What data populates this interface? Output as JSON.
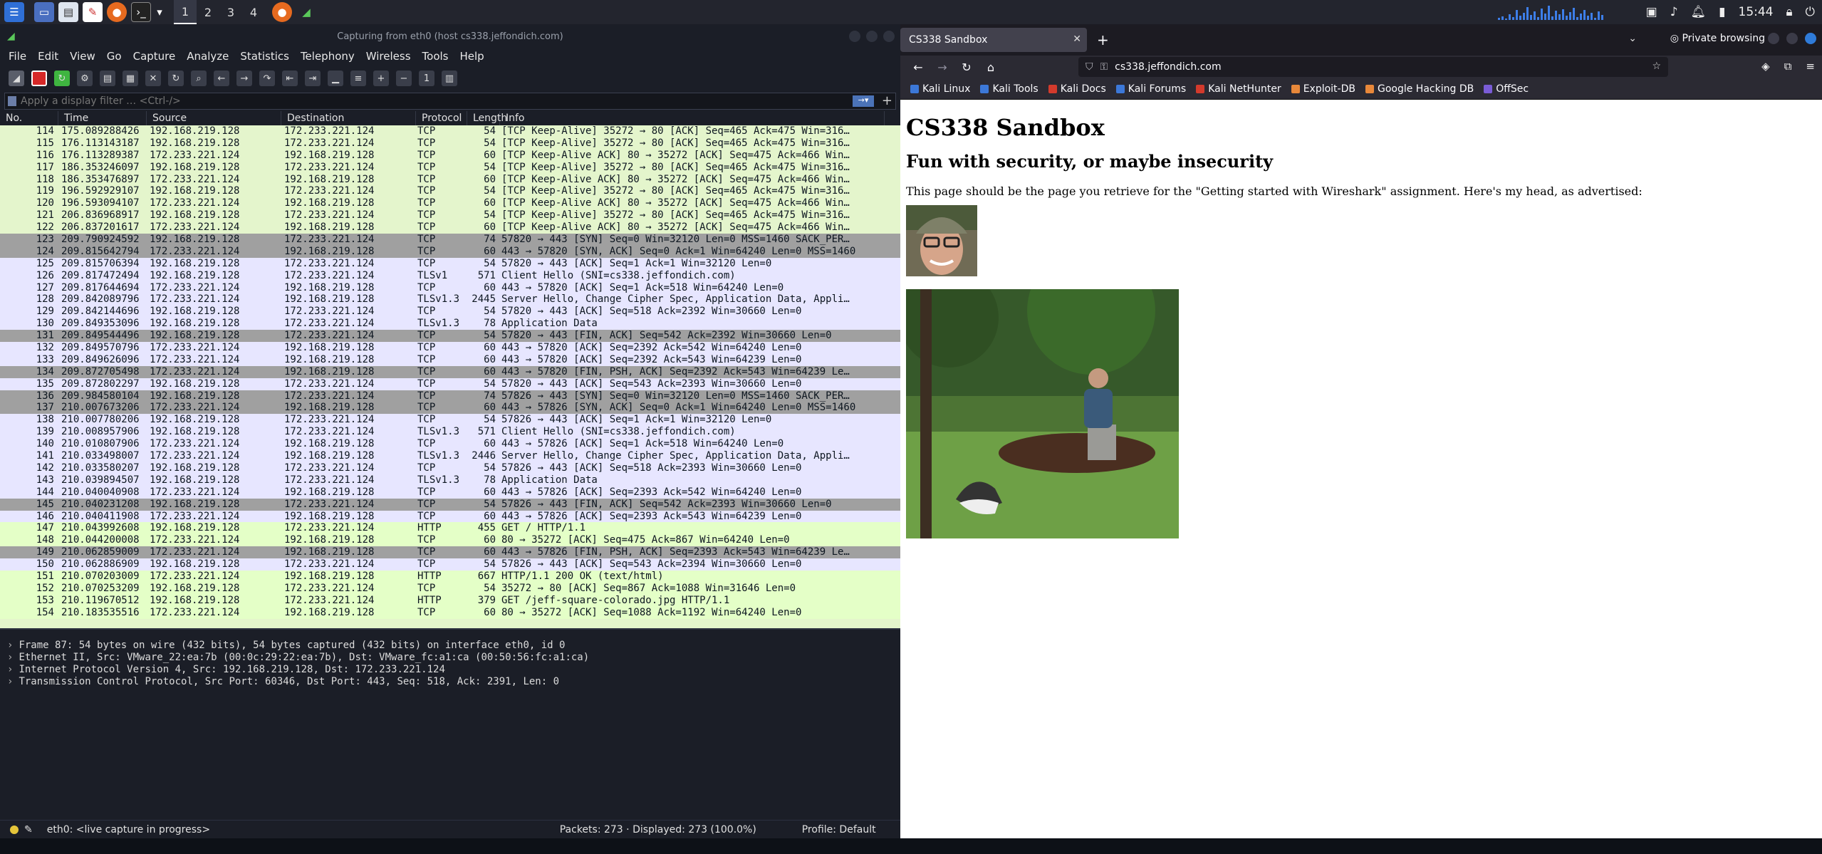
{
  "topbar": {
    "workspaces": [
      "1",
      "2",
      "3",
      "4"
    ],
    "clock": "15:44"
  },
  "wireshark": {
    "title": "Capturing from eth0 (host cs338.jeffondich.com)",
    "menu": [
      "File",
      "Edit",
      "View",
      "Go",
      "Capture",
      "Analyze",
      "Statistics",
      "Telephony",
      "Wireless",
      "Tools",
      "Help"
    ],
    "filter_placeholder": "Apply a display filter … <Ctrl-/>",
    "columns": [
      "No.",
      "Time",
      "Source",
      "Destination",
      "Protocol",
      "Length",
      "Info"
    ],
    "packets": [
      {
        "no": "114",
        "time": "175.089288426",
        "src": "192.168.219.128",
        "dst": "172.233.221.124",
        "proto": "TCP",
        "len": "54",
        "info": "[TCP Keep-Alive] 35272 → 80 [ACK] Seq=465 Ack=475 Win=316…",
        "cls": "ka"
      },
      {
        "no": "115",
        "time": "176.113143187",
        "src": "192.168.219.128",
        "dst": "172.233.221.124",
        "proto": "TCP",
        "len": "54",
        "info": "[TCP Keep-Alive] 35272 → 80 [ACK] Seq=465 Ack=475 Win=316…",
        "cls": "ka"
      },
      {
        "no": "116",
        "time": "176.113289387",
        "src": "172.233.221.124",
        "dst": "192.168.219.128",
        "proto": "TCP",
        "len": "60",
        "info": "[TCP Keep-Alive ACK] 80 → 35272 [ACK] Seq=475 Ack=466 Win…",
        "cls": "ka"
      },
      {
        "no": "117",
        "time": "186.353246097",
        "src": "192.168.219.128",
        "dst": "172.233.221.124",
        "proto": "TCP",
        "len": "54",
        "info": "[TCP Keep-Alive] 35272 → 80 [ACK] Seq=465 Ack=475 Win=316…",
        "cls": "ka"
      },
      {
        "no": "118",
        "time": "186.353476897",
        "src": "172.233.221.124",
        "dst": "192.168.219.128",
        "proto": "TCP",
        "len": "60",
        "info": "[TCP Keep-Alive ACK] 80 → 35272 [ACK] Seq=475 Ack=466 Win…",
        "cls": "ka"
      },
      {
        "no": "119",
        "time": "196.592929107",
        "src": "192.168.219.128",
        "dst": "172.233.221.124",
        "proto": "TCP",
        "len": "54",
        "info": "[TCP Keep-Alive] 35272 → 80 [ACK] Seq=465 Ack=475 Win=316…",
        "cls": "ka"
      },
      {
        "no": "120",
        "time": "196.593094107",
        "src": "172.233.221.124",
        "dst": "192.168.219.128",
        "proto": "TCP",
        "len": "60",
        "info": "[TCP Keep-Alive ACK] 80 → 35272 [ACK] Seq=475 Ack=466 Win…",
        "cls": "ka"
      },
      {
        "no": "121",
        "time": "206.836968917",
        "src": "192.168.219.128",
        "dst": "172.233.221.124",
        "proto": "TCP",
        "len": "54",
        "info": "[TCP Keep-Alive] 35272 → 80 [ACK] Seq=465 Ack=475 Win=316…",
        "cls": "ka"
      },
      {
        "no": "122",
        "time": "206.837201617",
        "src": "172.233.221.124",
        "dst": "192.168.219.128",
        "proto": "TCP",
        "len": "60",
        "info": "[TCP Keep-Alive ACK] 80 → 35272 [ACK] Seq=475 Ack=466 Win…",
        "cls": "ka"
      },
      {
        "no": "123",
        "time": "209.790924592",
        "src": "192.168.219.128",
        "dst": "172.233.221.124",
        "proto": "TCP",
        "len": "74",
        "info": "57820 → 443 [SYN] Seq=0 Win=32120 Len=0 MSS=1460 SACK_PER…",
        "cls": "syn"
      },
      {
        "no": "124",
        "time": "209.815642794",
        "src": "172.233.221.124",
        "dst": "192.168.219.128",
        "proto": "TCP",
        "len": "60",
        "info": "443 → 57820 [SYN, ACK] Seq=0 Ack=1 Win=64240 Len=0 MSS=1460",
        "cls": "syn"
      },
      {
        "no": "125",
        "time": "209.815706394",
        "src": "192.168.219.128",
        "dst": "172.233.221.124",
        "proto": "TCP",
        "len": "54",
        "info": "57820 → 443 [ACK] Seq=1 Ack=1 Win=32120 Len=0",
        "cls": "tcp"
      },
      {
        "no": "126",
        "time": "209.817472494",
        "src": "192.168.219.128",
        "dst": "172.233.221.124",
        "proto": "TLSv1",
        "len": "571",
        "info": "Client Hello (SNI=cs338.jeffondich.com)",
        "cls": "tcp"
      },
      {
        "no": "127",
        "time": "209.817644694",
        "src": "172.233.221.124",
        "dst": "192.168.219.128",
        "proto": "TCP",
        "len": "60",
        "info": "443 → 57820 [ACK] Seq=1 Ack=518 Win=64240 Len=0",
        "cls": "tcp"
      },
      {
        "no": "128",
        "time": "209.842089796",
        "src": "172.233.221.124",
        "dst": "192.168.219.128",
        "proto": "TLSv1.3",
        "len": "2445",
        "info": "Server Hello, Change Cipher Spec, Application Data, Appli…",
        "cls": "tcp"
      },
      {
        "no": "129",
        "time": "209.842144696",
        "src": "192.168.219.128",
        "dst": "172.233.221.124",
        "proto": "TCP",
        "len": "54",
        "info": "57820 → 443 [ACK] Seq=518 Ack=2392 Win=30660 Len=0",
        "cls": "tcp"
      },
      {
        "no": "130",
        "time": "209.849353096",
        "src": "192.168.219.128",
        "dst": "172.233.221.124",
        "proto": "TLSv1.3",
        "len": "78",
        "info": "Application Data",
        "cls": "tcp"
      },
      {
        "no": "131",
        "time": "209.849544496",
        "src": "192.168.219.128",
        "dst": "172.233.221.124",
        "proto": "TCP",
        "len": "54",
        "info": "57820 → 443 [FIN, ACK] Seq=542 Ack=2392 Win=30660 Len=0",
        "cls": "syn"
      },
      {
        "no": "132",
        "time": "209.849570796",
        "src": "172.233.221.124",
        "dst": "192.168.219.128",
        "proto": "TCP",
        "len": "60",
        "info": "443 → 57820 [ACK] Seq=2392 Ack=542 Win=64240 Len=0",
        "cls": "tcp"
      },
      {
        "no": "133",
        "time": "209.849626096",
        "src": "172.233.221.124",
        "dst": "192.168.219.128",
        "proto": "TCP",
        "len": "60",
        "info": "443 → 57820 [ACK] Seq=2392 Ack=543 Win=64239 Len=0",
        "cls": "tcp"
      },
      {
        "no": "134",
        "time": "209.872705498",
        "src": "172.233.221.124",
        "dst": "192.168.219.128",
        "proto": "TCP",
        "len": "60",
        "info": "443 → 57820 [FIN, PSH, ACK] Seq=2392 Ack=543 Win=64239 Le…",
        "cls": "syn"
      },
      {
        "no": "135",
        "time": "209.872802297",
        "src": "192.168.219.128",
        "dst": "172.233.221.124",
        "proto": "TCP",
        "len": "54",
        "info": "57820 → 443 [ACK] Seq=543 Ack=2393 Win=30660 Len=0",
        "cls": "tcp"
      },
      {
        "no": "136",
        "time": "209.984580104",
        "src": "192.168.219.128",
        "dst": "172.233.221.124",
        "proto": "TCP",
        "len": "74",
        "info": "57826 → 443 [SYN] Seq=0 Win=32120 Len=0 MSS=1460 SACK_PER…",
        "cls": "syn"
      },
      {
        "no": "137",
        "time": "210.007673206",
        "src": "172.233.221.124",
        "dst": "192.168.219.128",
        "proto": "TCP",
        "len": "60",
        "info": "443 → 57826 [SYN, ACK] Seq=0 Ack=1 Win=64240 Len=0 MSS=1460",
        "cls": "syn"
      },
      {
        "no": "138",
        "time": "210.007780206",
        "src": "192.168.219.128",
        "dst": "172.233.221.124",
        "proto": "TCP",
        "len": "54",
        "info": "57826 → 443 [ACK] Seq=1 Ack=1 Win=32120 Len=0",
        "cls": "tcp"
      },
      {
        "no": "139",
        "time": "210.008957906",
        "src": "192.168.219.128",
        "dst": "172.233.221.124",
        "proto": "TLSv1.3",
        "len": "571",
        "info": "Client Hello (SNI=cs338.jeffondich.com)",
        "cls": "tcp"
      },
      {
        "no": "140",
        "time": "210.010807906",
        "src": "172.233.221.124",
        "dst": "192.168.219.128",
        "proto": "TCP",
        "len": "60",
        "info": "443 → 57826 [ACK] Seq=1 Ack=518 Win=64240 Len=0",
        "cls": "tcp"
      },
      {
        "no": "141",
        "time": "210.033498007",
        "src": "172.233.221.124",
        "dst": "192.168.219.128",
        "proto": "TLSv1.3",
        "len": "2446",
        "info": "Server Hello, Change Cipher Spec, Application Data, Appli…",
        "cls": "tcp"
      },
      {
        "no": "142",
        "time": "210.033580207",
        "src": "192.168.219.128",
        "dst": "172.233.221.124",
        "proto": "TCP",
        "len": "54",
        "info": "57826 → 443 [ACK] Seq=518 Ack=2393 Win=30660 Len=0",
        "cls": "tcp"
      },
      {
        "no": "143",
        "time": "210.039894507",
        "src": "192.168.219.128",
        "dst": "172.233.221.124",
        "proto": "TLSv1.3",
        "len": "78",
        "info": "Application Data",
        "cls": "tcp"
      },
      {
        "no": "144",
        "time": "210.040040908",
        "src": "172.233.221.124",
        "dst": "192.168.219.128",
        "proto": "TCP",
        "len": "60",
        "info": "443 → 57826 [ACK] Seq=2393 Ack=542 Win=64240 Len=0",
        "cls": "tcp"
      },
      {
        "no": "145",
        "time": "210.040231208",
        "src": "192.168.219.128",
        "dst": "172.233.221.124",
        "proto": "TCP",
        "len": "54",
        "info": "57826 → 443 [FIN, ACK] Seq=542 Ack=2393 Win=30660 Len=0",
        "cls": "syn"
      },
      {
        "no": "146",
        "time": "210.040411908",
        "src": "172.233.221.124",
        "dst": "192.168.219.128",
        "proto": "TCP",
        "len": "60",
        "info": "443 → 57826 [ACK] Seq=2393 Ack=543 Win=64239 Len=0",
        "cls": "tcp"
      },
      {
        "no": "147",
        "time": "210.043992608",
        "src": "192.168.219.128",
        "dst": "172.233.221.124",
        "proto": "HTTP",
        "len": "455",
        "info": "GET / HTTP/1.1",
        "cls": "http"
      },
      {
        "no": "148",
        "time": "210.044200008",
        "src": "172.233.221.124",
        "dst": "192.168.219.128",
        "proto": "TCP",
        "len": "60",
        "info": "80 → 35272 [ACK] Seq=475 Ack=867 Win=64240 Len=0",
        "cls": "http"
      },
      {
        "no": "149",
        "time": "210.062859009",
        "src": "172.233.221.124",
        "dst": "192.168.219.128",
        "proto": "TCP",
        "len": "60",
        "info": "443 → 57826 [FIN, PSH, ACK] Seq=2393 Ack=543 Win=64239 Le…",
        "cls": "syn"
      },
      {
        "no": "150",
        "time": "210.062886909",
        "src": "192.168.219.128",
        "dst": "172.233.221.124",
        "proto": "TCP",
        "len": "54",
        "info": "57826 → 443 [ACK] Seq=543 Ack=2394 Win=30660 Len=0",
        "cls": "tcp"
      },
      {
        "no": "151",
        "time": "210.070203009",
        "src": "172.233.221.124",
        "dst": "192.168.219.128",
        "proto": "HTTP",
        "len": "667",
        "info": "HTTP/1.1 200 OK  (text/html)",
        "cls": "http"
      },
      {
        "no": "152",
        "time": "210.070253209",
        "src": "192.168.219.128",
        "dst": "172.233.221.124",
        "proto": "TCP",
        "len": "54",
        "info": "35272 → 80 [ACK] Seq=867 Ack=1088 Win=31646 Len=0",
        "cls": "http"
      },
      {
        "no": "153",
        "time": "210.119670512",
        "src": "192.168.219.128",
        "dst": "172.233.221.124",
        "proto": "HTTP",
        "len": "379",
        "info": "GET /jeff-square-colorado.jpg HTTP/1.1",
        "cls": "http"
      },
      {
        "no": "154",
        "time": "210.183535516",
        "src": "172.233.221.124",
        "dst": "192.168.219.128",
        "proto": "TCP",
        "len": "60",
        "info": "80 → 35272 [ACK] Seq=1088 Ack=1192 Win=64240 Len=0",
        "cls": "http"
      }
    ],
    "details": [
      "Frame 87: 54 bytes on wire (432 bits), 54 bytes captured (432 bits) on interface eth0, id 0",
      "Ethernet II, Src: VMware_22:ea:7b (00:0c:29:22:ea:7b), Dst: VMware_fc:a1:ca (00:50:56:fc:a1:ca)",
      "Internet Protocol Version 4, Src: 192.168.219.128, Dst: 172.233.221.124",
      "Transmission Control Protocol, Src Port: 60346, Dst Port: 443, Seq: 518, Ack: 2391, Len: 0"
    ],
    "status": {
      "interface": "eth0: <live capture in progress>",
      "packets": "Packets: 273 · Displayed: 273 (100.0%)",
      "profile": "Profile: Default"
    }
  },
  "browser": {
    "tab_title": "CS338 Sandbox",
    "private_label": "Private browsing",
    "url": "cs338.jeffondich.com",
    "bookmarks": [
      {
        "label": "Kali Linux",
        "color": "#3c78d8"
      },
      {
        "label": "Kali Tools",
        "color": "#3c78d8"
      },
      {
        "label": "Kali Docs",
        "color": "#d33a2c"
      },
      {
        "label": "Kali Forums",
        "color": "#3c78d8"
      },
      {
        "label": "Kali NetHunter",
        "color": "#d33a2c"
      },
      {
        "label": "Exploit-DB",
        "color": "#e8883a"
      },
      {
        "label": "Google Hacking DB",
        "color": "#e8883a"
      },
      {
        "label": "OffSec",
        "color": "#7a5cd6"
      }
    ],
    "page": {
      "h1": "CS338 Sandbox",
      "h2": "Fun with security, or maybe insecurity",
      "para": "This page should be the page you retrieve for the \"Getting started with Wireshark\" assignment. Here's my head, as advertised:"
    }
  }
}
